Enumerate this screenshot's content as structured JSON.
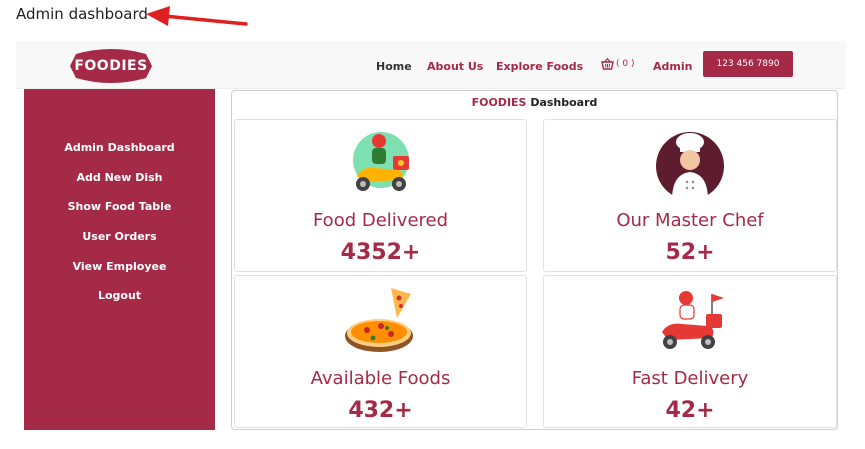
{
  "annotation": {
    "label": "Admin dashboard",
    "arrow_color": "#e02020"
  },
  "brand": {
    "logo_text": "FOODIES",
    "accent": "#a52a48"
  },
  "navbar": {
    "home": "Home",
    "about": "About Us",
    "explore": "Explore Foods",
    "cart_count": "( 0 )",
    "admin": "Admin",
    "phone": "123 456 7890"
  },
  "sidebar": {
    "items": [
      {
        "label": "Admin Dashboard"
      },
      {
        "label": "Add New Dish"
      },
      {
        "label": "Show Food Table"
      },
      {
        "label": "User Orders"
      },
      {
        "label": "View Employee"
      },
      {
        "label": "Logout"
      }
    ]
  },
  "dashboard": {
    "title_brand": "FOODIES",
    "title_rest": " Dashboard",
    "cards": [
      {
        "label": "Food Delivered",
        "value": "4352+",
        "icon": "delivery-scooter-icon"
      },
      {
        "label": "Our Master Chef",
        "value": "52+",
        "icon": "chef-icon"
      },
      {
        "label": "Available Foods",
        "value": "432+",
        "icon": "pizza-icon"
      },
      {
        "label": "Fast Delivery",
        "value": "42+",
        "icon": "fast-delivery-icon"
      }
    ]
  }
}
